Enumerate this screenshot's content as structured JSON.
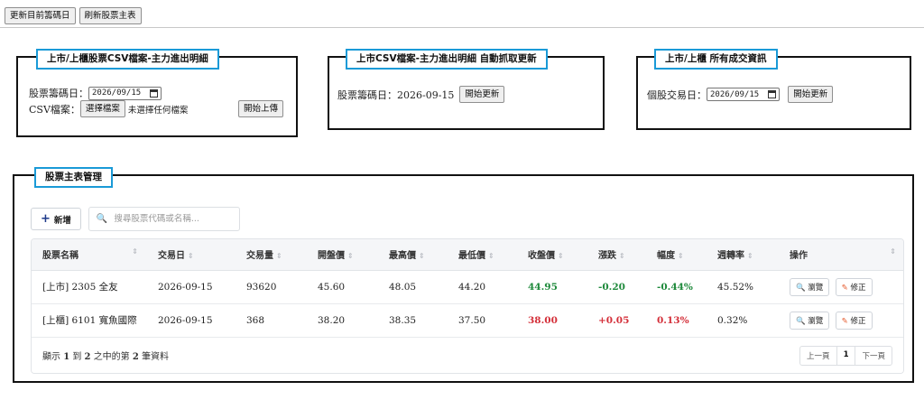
{
  "toolbar": {
    "update_chips_label": "更新目前籌碼日",
    "refresh_master_label": "刷新股票主表"
  },
  "panel_upload": {
    "title": "上市/上櫃股票CSV檔案-主力進出明細",
    "date_label": "股票籌碼日：",
    "date_value": "2026/09/15",
    "file_label": "CSV檔案：",
    "choose_file_label": "選擇檔案",
    "no_file_text": "未選擇任何檔案",
    "upload_label": "開始上傳"
  },
  "panel_auto": {
    "title": "上市CSV檔案-主力進出明細 自動抓取更新",
    "date_label": "股票籌碼日：2026-09-15",
    "update_label": "開始更新"
  },
  "panel_trade": {
    "title": "上市/上櫃 所有成交資訊",
    "date_label": "個股交易日：",
    "date_value": "2026/09/15",
    "update_label": "開始更新"
  },
  "master": {
    "title": "股票主表管理",
    "add_label": "新增",
    "search_placeholder": "搜尋股票代碼或名稱...",
    "columns": [
      "股票名稱",
      "交易日",
      "交易量",
      "開盤價",
      "最高價",
      "最低價",
      "收盤價",
      "漲跌",
      "幅度",
      "週轉率",
      "操作"
    ],
    "rows": [
      {
        "name": "[上市] 2305 全友",
        "date": "2026-09-15",
        "volume": "93620",
        "open": "45.60",
        "high": "48.05",
        "low": "44.20",
        "close": "44.95",
        "change": "-0.20",
        "pct": "-0.44%",
        "turnover": "45.52%",
        "direction": "down"
      },
      {
        "name": "[上櫃] 6101 寬魚國際",
        "date": "2026-09-15",
        "volume": "368",
        "open": "38.20",
        "high": "38.35",
        "low": "37.50",
        "close": "38.00",
        "change": "+0.05",
        "pct": "0.13%",
        "turnover": "0.32%",
        "direction": "up"
      }
    ],
    "view_label": "瀏覽",
    "edit_label": "修正",
    "info_prefix": "顯示",
    "info_start": "1",
    "info_to": "到",
    "info_end": "2",
    "info_mid": "之中的第",
    "info_total": "2",
    "info_suffix": "筆資料",
    "pager": {
      "prev": "上一頁",
      "current": "1",
      "next": "下一頁"
    }
  },
  "colors": {
    "up": "#d4303a",
    "down": "#1f8a3c",
    "legend_border": "#1a9ad7",
    "accent": "#2563eb"
  },
  "icons": {
    "add": "plus-icon",
    "search": "search-icon",
    "view": "view-icon",
    "edit": "pencil-icon",
    "sort": "sort-icon",
    "calendar": "calendar-icon"
  }
}
